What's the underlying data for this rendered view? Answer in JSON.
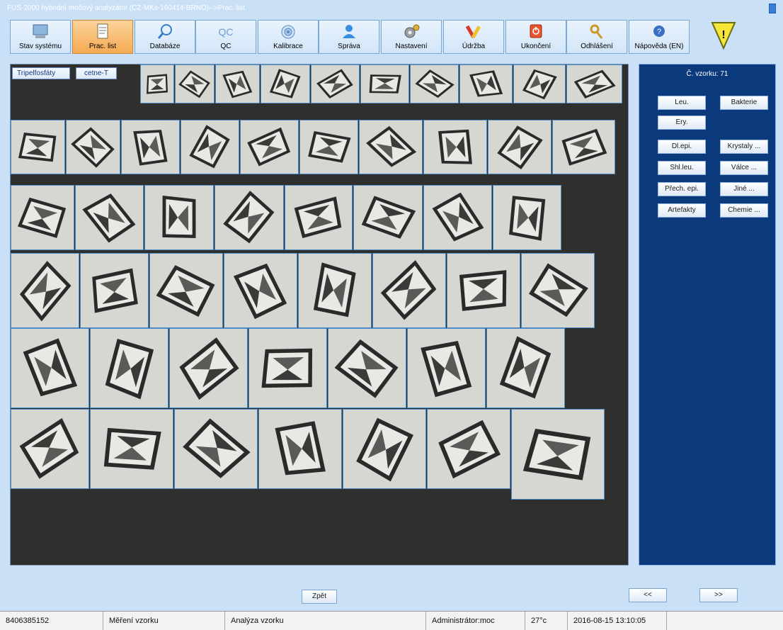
{
  "window": {
    "title": "FUS-2000 hybridní močový analyzátor (CZ-MKs-160414-BRNO)-->Prac. list"
  },
  "toolbar": {
    "buttons": [
      {
        "label": "Stav systému",
        "icon": "monitor-icon"
      },
      {
        "label": "Prac. list",
        "icon": "worklist-icon",
        "active": true
      },
      {
        "label": "Databáze",
        "icon": "magnifier-icon"
      },
      {
        "label": "QC",
        "icon": "qc-icon"
      },
      {
        "label": "Kalibrace",
        "icon": "target-icon"
      },
      {
        "label": "Správa",
        "icon": "user-icon"
      },
      {
        "label": "Nastavení",
        "icon": "gears-icon"
      },
      {
        "label": "Údržba",
        "icon": "tools-icon"
      },
      {
        "label": "Ukončení",
        "icon": "power-icon"
      },
      {
        "label": "Odhlášení",
        "icon": "key-icon"
      },
      {
        "label": "Nápověda (EN)",
        "icon": "help-icon"
      }
    ],
    "qc_icon_text": "QC",
    "warning_symbol": "!"
  },
  "tags": [
    "Tripelfosfáty",
    "cetne-T"
  ],
  "side_panel": {
    "sample_label": "Č. vzorku: 71",
    "buttons": [
      "Leu.",
      "Bakterie",
      "Ery.",
      "Dl.epi.",
      "Krystaly ...",
      "Shl.leu.",
      "Válce ...",
      "Přech. epi.",
      "Jiné ...",
      "Artefakty",
      "Chemie ..."
    ]
  },
  "navigation": {
    "back": "Zpět",
    "prev": "<<",
    "next": ">>"
  },
  "status_bar": {
    "id": "8406385152",
    "measure": "Měření vzorku",
    "analysis": "Analýza vzorku",
    "user": "Administrátor:moc",
    "temperature": "27°c",
    "datetime": "2016-08-15 13:10:05"
  },
  "colors": {
    "background": "#c9e0f6",
    "image_area": "#2f2f2e",
    "side_panel": "#0b3a7c",
    "active_tab": "#f5aa52"
  }
}
